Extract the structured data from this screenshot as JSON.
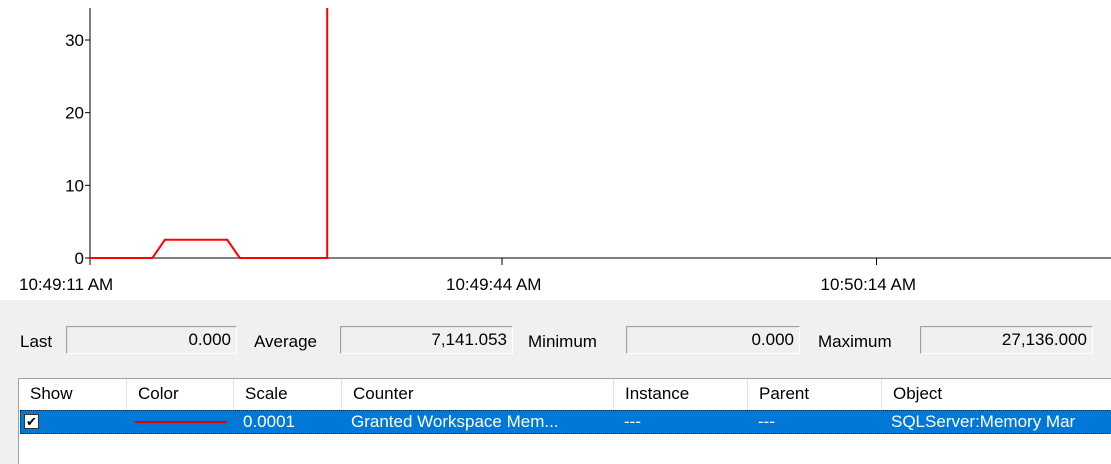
{
  "chart_data": {
    "type": "line",
    "series": [
      {
        "color": "#ff0000",
        "points": [
          [
            "10:49:11 AM",
            0
          ],
          [
            "10:49:16 AM",
            0
          ],
          [
            "10:49:17 AM",
            2.5
          ],
          [
            "10:49:22 AM",
            2.5
          ],
          [
            "10:49:23 AM",
            0
          ],
          [
            "10:49:30 AM",
            0
          ],
          [
            "10:49:30 AM",
            35
          ]
        ]
      }
    ],
    "y_ticks": [
      "0",
      "10",
      "20",
      "30"
    ],
    "ylim": [
      0,
      35
    ],
    "x_ticks": [
      "10:49:11 AM",
      "10:49:44 AM",
      "10:50:14 AM"
    ]
  },
  "stats": {
    "last_label": "Last",
    "last_value": "0.000",
    "average_label": "Average",
    "average_value": "7,141.053",
    "minimum_label": "Minimum",
    "minimum_value": "0.000",
    "maximum_label": "Maximum",
    "maximum_value": "27,136.000"
  },
  "table": {
    "columns": [
      "Show",
      "Color",
      "Scale",
      "Counter",
      "Instance",
      "Parent",
      "Object"
    ],
    "rows": [
      {
        "show_check": "✔",
        "color": "#e00000",
        "scale": "0.0001",
        "counter": "Granted Workspace Mem...",
        "instance": "---",
        "parent": "---",
        "object": "SQLServer:Memory Mar"
      }
    ]
  }
}
